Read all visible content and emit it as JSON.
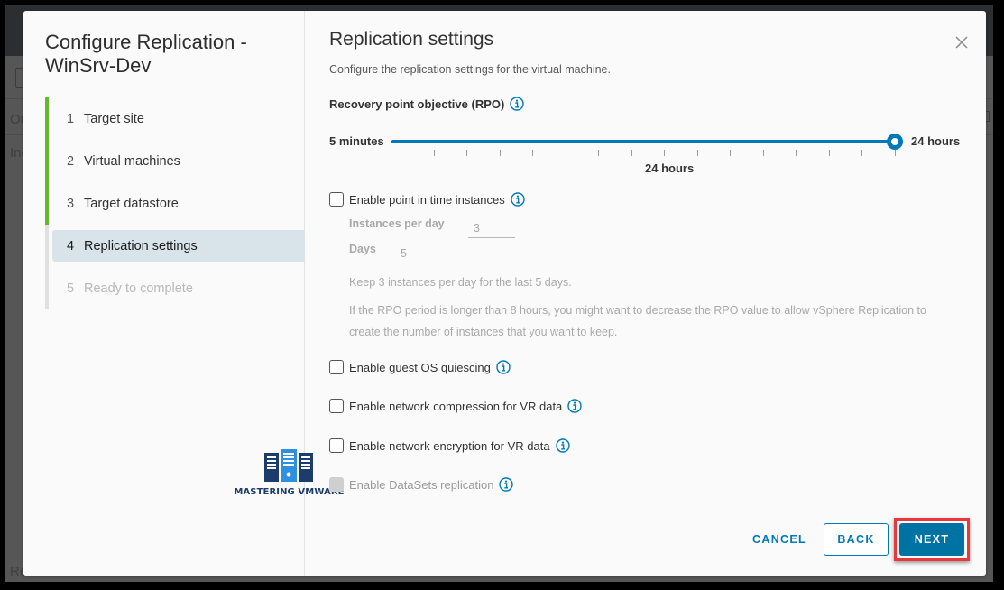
{
  "background": {
    "fragments": [
      "Ou",
      "Inc",
      "Re"
    ]
  },
  "wizard": {
    "title": "Configure Replication - WinSrv-Dev",
    "steps": [
      {
        "num": "1",
        "label": "Target site",
        "state": "done"
      },
      {
        "num": "2",
        "label": "Virtual machines",
        "state": "done"
      },
      {
        "num": "3",
        "label": "Target datastore",
        "state": "done"
      },
      {
        "num": "4",
        "label": "Replication settings",
        "state": "active"
      },
      {
        "num": "5",
        "label": "Ready to complete",
        "state": "disabled"
      }
    ]
  },
  "watermark": {
    "text": "MASTERING VMWARE"
  },
  "page": {
    "title": "Replication settings",
    "subtitle": "Configure the replication settings for the virtual machine.",
    "close_icon": "close-icon"
  },
  "rpo": {
    "label": "Recovery point objective (RPO)",
    "min_label": "5 minutes",
    "max_label": "24 hours",
    "value_label": "24 hours",
    "value_fraction": 1.0,
    "tick_count": 16,
    "colors": {
      "accent": "#0079b8"
    }
  },
  "pit": {
    "label": "Enable point in time instances",
    "checked": false,
    "instances_label": "Instances per day",
    "instances_value": "3",
    "days_label": "Days",
    "days_value": "5",
    "help1": "Keep 3 instances per day for the last 5 days.",
    "help2": "If the RPO period is longer than 8 hours, you might want to decrease the RPO value to allow vSphere Replication to create the number of instances that you want to keep."
  },
  "options": {
    "quiescing": {
      "label": "Enable guest OS quiescing",
      "checked": false
    },
    "compression": {
      "label": "Enable network compression for VR data",
      "checked": false
    },
    "encryption": {
      "label": "Enable network encryption for VR data",
      "checked": false
    },
    "datasets": {
      "label": "Enable DataSets replication",
      "checked": false,
      "disabled": true
    }
  },
  "footer": {
    "cancel": "CANCEL",
    "back": "BACK",
    "next": "NEXT",
    "highlight_color": "#e8383d"
  }
}
